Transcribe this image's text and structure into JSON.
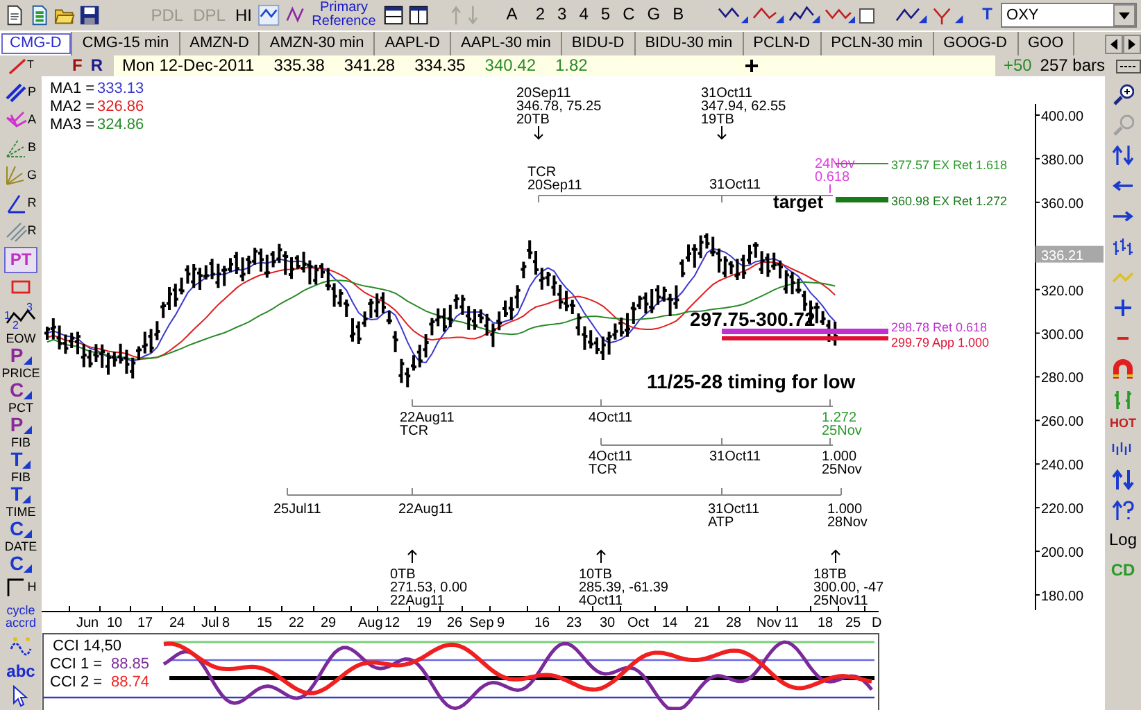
{
  "toolbar": {
    "text_buttons": [
      {
        "label": "PDL",
        "disabled": true
      },
      {
        "label": "DPL",
        "disabled": true
      },
      {
        "label": "HI",
        "disabled": false
      }
    ],
    "reference_button": {
      "line_1": "Primary",
      "line_2": "Reference"
    },
    "letter_buttons": [
      "A",
      "2",
      "3",
      "4",
      "5",
      "C",
      "G",
      "B"
    ],
    "checkbox": {
      "checked": false
    },
    "text_tool_letter": "T",
    "symbol_field": {
      "value": "OXY"
    }
  },
  "tabs": [
    {
      "label": "CMG-D",
      "selected": true
    },
    {
      "label": "CMG-15 min",
      "selected": false
    },
    {
      "label": "AMZN-D",
      "selected": false
    },
    {
      "label": "AMZN-30 min",
      "selected": false
    },
    {
      "label": "AAPL-D",
      "selected": false
    },
    {
      "label": "AAPL-30 min",
      "selected": false
    },
    {
      "label": "BIDU-D",
      "selected": false
    },
    {
      "label": "BIDU-30 min",
      "selected": false
    },
    {
      "label": "PCLN-D",
      "selected": false
    },
    {
      "label": "PCLN-30 min",
      "selected": false
    },
    {
      "label": "GOOG-D",
      "selected": false
    },
    {
      "label": "GOO",
      "selected": false
    }
  ],
  "info_bar": {
    "tool_letter": "T",
    "flags": [
      "F",
      "R"
    ],
    "date": "Mon 12-Dec-2011",
    "prices": [
      "335.38",
      "341.28",
      "334.35"
    ],
    "close": "340.42",
    "change": "1.82",
    "offset": "+50",
    "bars": "257 bars"
  },
  "left_tools": [
    {
      "kind": "tool",
      "letter": "P"
    },
    {
      "kind": "tool",
      "letter": "A"
    },
    {
      "kind": "tool",
      "letter": "B"
    },
    {
      "kind": "tool",
      "letter": "G"
    },
    {
      "kind": "tool",
      "letter": "R"
    },
    {
      "kind": "tool",
      "letter": "R"
    },
    {
      "kind": "boxed",
      "letter": "PT"
    },
    {
      "kind": "tool"
    },
    {
      "kind": "wave",
      "digits": [
        "1",
        "2",
        "3"
      ]
    },
    {
      "kind": "labeled",
      "caption": "EOW",
      "letter": "P"
    },
    {
      "kind": "labeled",
      "caption": "PRICE",
      "letter": "C"
    },
    {
      "kind": "labeled",
      "caption": "PCT",
      "letter": "P"
    },
    {
      "kind": "labeled",
      "caption": "FIB",
      "letter": "T"
    },
    {
      "kind": "labeled",
      "caption": "FIB",
      "letter": "T"
    },
    {
      "kind": "labeled",
      "caption": "TIME",
      "letter": "C"
    },
    {
      "kind": "labeled",
      "caption": "DATE",
      "letter": "C"
    },
    {
      "kind": "tool",
      "letter": "H"
    },
    {
      "kind": "caption",
      "caption": "cycle accrd"
    },
    {
      "kind": "tool"
    },
    {
      "kind": "caption",
      "caption": "abc"
    },
    {
      "kind": "tool"
    }
  ],
  "right_tools": [
    {
      "kind": "icon"
    },
    {
      "kind": "icon"
    },
    {
      "kind": "icon"
    },
    {
      "kind": "icon"
    },
    {
      "kind": "icon"
    },
    {
      "kind": "icon"
    },
    {
      "kind": "icon"
    },
    {
      "kind": "icon"
    },
    {
      "kind": "icon"
    },
    {
      "kind": "icon"
    },
    {
      "kind": "icon"
    },
    {
      "kind": "text",
      "label": "HOT"
    },
    {
      "kind": "icon"
    },
    {
      "kind": "icon"
    },
    {
      "kind": "icon"
    },
    {
      "kind": "text",
      "label": "Log"
    },
    {
      "kind": "text",
      "label": "CD"
    }
  ],
  "chart": {
    "moving_averages": [
      {
        "label": "MA1 =",
        "value": "333.13",
        "color": "#3a3ad0"
      },
      {
        "label": "MA2 =",
        "value": "326.86",
        "color": "#e02020"
      },
      {
        "label": "MA3 =",
        "value": "324.86",
        "color": "#2a8a2a"
      }
    ],
    "annotations": [
      {
        "kind": "label",
        "color": "#000000",
        "lines": [
          "20Sep11",
          "346.78, 75.25",
          "20TB"
        ]
      },
      {
        "kind": "label",
        "color": "#000000",
        "lines": [
          "31Oct11",
          "347.94, 62.55",
          "19TB"
        ]
      },
      {
        "kind": "label",
        "color": "#000000",
        "lines": [
          "TCR",
          "20Sep11"
        ]
      },
      {
        "kind": "label",
        "color": "#000000",
        "lines": [
          "31Oct11"
        ]
      },
      {
        "kind": "label",
        "color": "#e040e0",
        "lines": [
          "24Nov",
          "0.618"
        ]
      },
      {
        "kind": "callout",
        "color": "#000000",
        "lines": [
          "target"
        ]
      },
      {
        "kind": "callout",
        "color": "#000000",
        "lines": [
          "297.75-300.72"
        ]
      },
      {
        "kind": "callout",
        "color": "#000000",
        "lines": [
          "11/25-28 timing for low"
        ]
      },
      {
        "kind": "label",
        "color": "#000000",
        "lines": [
          "22Aug11",
          "TCR"
        ]
      },
      {
        "kind": "label",
        "color": "#000000",
        "lines": [
          "4Oct11"
        ]
      },
      {
        "kind": "label",
        "color": "#2a9a2a",
        "lines": [
          "1.272",
          "25Nov"
        ]
      },
      {
        "kind": "label",
        "color": "#000000",
        "lines": [
          "4Oct11",
          "TCR"
        ]
      },
      {
        "kind": "label",
        "color": "#000000",
        "lines": [
          "31Oct11"
        ]
      },
      {
        "kind": "label",
        "color": "#000000",
        "lines": [
          "1.000",
          "25Nov"
        ]
      },
      {
        "kind": "label",
        "color": "#000000",
        "lines": [
          "25Jul11"
        ]
      },
      {
        "kind": "label",
        "color": "#000000",
        "lines": [
          "22Aug11"
        ]
      },
      {
        "kind": "label",
        "color": "#000000",
        "lines": [
          "31Oct11",
          "ATP"
        ]
      },
      {
        "kind": "label",
        "color": "#000000",
        "lines": [
          "1.000",
          "28Nov"
        ]
      },
      {
        "kind": "label",
        "color": "#000000",
        "lines": [
          "0TB",
          "271.53, 0.00",
          "22Aug11"
        ]
      },
      {
        "kind": "label",
        "color": "#000000",
        "lines": [
          "10TB",
          "285.39, -61.39",
          "4Oct11"
        ]
      },
      {
        "kind": "label",
        "color": "#000000",
        "lines": [
          "18TB",
          "300.00, -47",
          "25Nov11"
        ]
      }
    ],
    "levels": [
      {
        "text": "377.57 EX Ret 1.618",
        "color": "#2a9a2a"
      },
      {
        "text": "360.98 EX Ret 1.272",
        "color": "#1a7a1a"
      },
      {
        "text": "298.78 Ret 0.618",
        "color": "#c030d0"
      },
      {
        "text": "299.79 App 1.000",
        "color": "#e01030"
      }
    ],
    "y_axis": [
      "400.00",
      "380.00",
      "360.00",
      "320.00",
      "300.00",
      "280.00",
      "260.00",
      "240.00",
      "220.00",
      "200.00",
      "180.00"
    ],
    "current_price": "336.21",
    "x_axis": [
      "Jun",
      "10",
      "17",
      "24",
      "Jul",
      "8",
      "15",
      "22",
      "29",
      "Aug",
      "12",
      "19",
      "26",
      "Sep",
      "9",
      "16",
      "23",
      "30",
      "Oct",
      "14",
      "21",
      "28",
      "Nov",
      "11",
      "18",
      "25",
      "D"
    ]
  },
  "cci": {
    "title": "CCI 14,50",
    "series": [
      {
        "label": "CCI 1 =",
        "value": "88.85",
        "color": "#7a2a9a"
      },
      {
        "label": "CCI 2 =",
        "value": "88.74",
        "color": "#f02020"
      }
    ]
  }
}
